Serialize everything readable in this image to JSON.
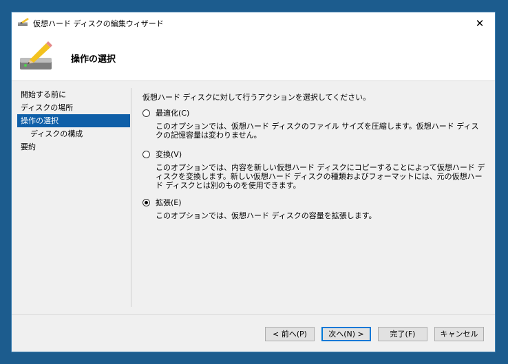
{
  "window": {
    "title": "仮想ハード ディスクの編集ウィザード",
    "close_glyph": "✕"
  },
  "header": {
    "title": "操作の選択"
  },
  "nav": {
    "items": [
      {
        "label": "開始する前に"
      },
      {
        "label": "ディスクの場所"
      },
      {
        "label": "操作の選択"
      },
      {
        "label": "ディスクの構成"
      },
      {
        "label": "要約"
      }
    ],
    "selected": "操作の選択"
  },
  "main": {
    "instruction": "仮想ハード ディスクに対して行うアクションを選択してください。",
    "options": [
      {
        "label": "最適化(C)",
        "checked": false,
        "description": "このオプションでは、仮想ハード ディスクのファイル サイズを圧縮します。仮想ハード ディスクの記憶容量は変わりません。"
      },
      {
        "label": "変換(V)",
        "checked": false,
        "description": "このオプションでは、内容を新しい仮想ハード ディスクにコピーすることによって仮想ハード ディスクを変換します。新しい仮想ハード ディスクの種類およびフォーマットには、元の仮想ハード ディスクとは別のものを使用できます。"
      },
      {
        "label": "拡張(E)",
        "checked": true,
        "description": "このオプションでは、仮想ハード ディスクの容量を拡張します。"
      }
    ]
  },
  "buttons": {
    "back": "< 前へ(P)",
    "next": "次へ(N) >",
    "finish": "完了(F)",
    "cancel": "キャンセル"
  }
}
